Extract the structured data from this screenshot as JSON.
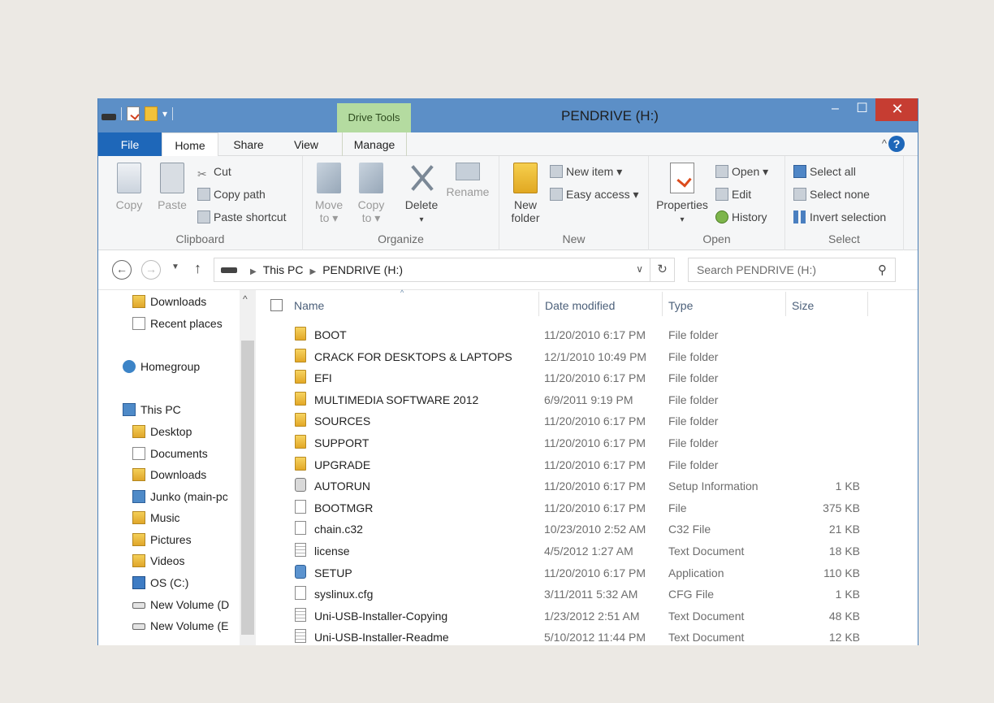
{
  "window": {
    "title": "PENDRIVE (H:)",
    "contextual_tab": "Drive Tools",
    "controls": {
      "minimize": "–",
      "maximize": "☐",
      "close": "✕"
    },
    "qat_dropdown": "▾"
  },
  "tabs": [
    {
      "label": "File"
    },
    {
      "label": "Home"
    },
    {
      "label": "Share"
    },
    {
      "label": "View"
    },
    {
      "label": "Manage"
    }
  ],
  "ribbon_misc": {
    "collapse": "^",
    "help": "?"
  },
  "ribbon": {
    "clipboard": {
      "label": "Clipboard",
      "copy": "Copy",
      "paste": "Paste",
      "cut": "Cut",
      "copy_path": "Copy path",
      "paste_shortcut": "Paste shortcut"
    },
    "organize": {
      "label": "Organize",
      "move_to_1": "Move",
      "move_to_2": "to ▾",
      "copy_to_1": "Copy",
      "copy_to_2": "to ▾",
      "delete": "Delete",
      "delete_dd": "▾",
      "rename": "Rename"
    },
    "new": {
      "label": "New",
      "new_folder_1": "New",
      "new_folder_2": "folder",
      "new_item": "New item ▾",
      "easy_access": "Easy access ▾"
    },
    "open": {
      "label": "Open",
      "properties": "Properties",
      "properties_dd": "▾",
      "open": "Open ▾",
      "edit": "Edit",
      "history": "History"
    },
    "select": {
      "label": "Select",
      "select_all": "Select all",
      "select_none": "Select none",
      "invert_selection": "Invert selection"
    }
  },
  "address": {
    "back": "←",
    "forward": "→",
    "recent": "▼",
    "up": "↑",
    "crumbs": [
      "This PC",
      "PENDRIVE (H:)"
    ],
    "crumb_sep": "▶",
    "dropdown": "∨",
    "refresh": "↻",
    "search_placeholder": "Search PENDRIVE (H:)",
    "search_glyph": "⚲"
  },
  "navpane": {
    "scroll_up": "^",
    "items": [
      {
        "label": "Downloads"
      },
      {
        "label": "Recent places"
      },
      {
        "label": "Homegroup"
      },
      {
        "label": "This PC"
      },
      {
        "label": "Desktop"
      },
      {
        "label": "Documents"
      },
      {
        "label": "Downloads"
      },
      {
        "label": "Junko (main-pc"
      },
      {
        "label": "Music"
      },
      {
        "label": "Pictures"
      },
      {
        "label": "Videos"
      },
      {
        "label": "OS (C:)"
      },
      {
        "label": "New Volume (D"
      },
      {
        "label": "New Volume (E"
      }
    ]
  },
  "columns": {
    "name": "Name",
    "date": "Date modified",
    "type": "Type",
    "size": "Size",
    "sort_arrow": "^"
  },
  "files": [
    {
      "name": "BOOT",
      "date": "11/20/2010 6:17 PM",
      "type": "File folder",
      "size": "",
      "icon": "folder-icon"
    },
    {
      "name": "CRACK FOR DESKTOPS & LAPTOPS",
      "date": "12/1/2010 10:49 PM",
      "type": "File folder",
      "size": "",
      "icon": "folder-icon"
    },
    {
      "name": "EFI",
      "date": "11/20/2010 6:17 PM",
      "type": "File folder",
      "size": "",
      "icon": "folder-icon"
    },
    {
      "name": "MULTIMEDIA SOFTWARE 2012",
      "date": "6/9/2011 9:19 PM",
      "type": "File folder",
      "size": "",
      "icon": "folder-icon"
    },
    {
      "name": "SOURCES",
      "date": "11/20/2010 6:17 PM",
      "type": "File folder",
      "size": "",
      "icon": "folder-icon"
    },
    {
      "name": "SUPPORT",
      "date": "11/20/2010 6:17 PM",
      "type": "File folder",
      "size": "",
      "icon": "folder-icon"
    },
    {
      "name": "UPGRADE",
      "date": "11/20/2010 6:17 PM",
      "type": "File folder",
      "size": "",
      "icon": "folder-icon"
    },
    {
      "name": "AUTORUN",
      "date": "11/20/2010 6:17 PM",
      "type": "Setup Information",
      "size": "1 KB",
      "icon": "setup-info-icon"
    },
    {
      "name": "BOOTMGR",
      "date": "11/20/2010 6:17 PM",
      "type": "File",
      "size": "375 KB",
      "icon": "file-icon"
    },
    {
      "name": "chain.c32",
      "date": "10/23/2010 2:52 AM",
      "type": "C32 File",
      "size": "21 KB",
      "icon": "file-icon"
    },
    {
      "name": "license",
      "date": "4/5/2012 1:27 AM",
      "type": "Text Document",
      "size": "18 KB",
      "icon": "text-document-icon"
    },
    {
      "name": "SETUP",
      "date": "11/20/2010 6:17 PM",
      "type": "Application",
      "size": "110 KB",
      "icon": "application-icon"
    },
    {
      "name": "syslinux.cfg",
      "date": "3/11/2011 5:32 AM",
      "type": "CFG File",
      "size": "1 KB",
      "icon": "file-icon"
    },
    {
      "name": "Uni-USB-Installer-Copying",
      "date": "1/23/2012 2:51 AM",
      "type": "Text Document",
      "size": "48 KB",
      "icon": "text-document-icon"
    },
    {
      "name": "Uni-USB-Installer-Readme",
      "date": "5/10/2012 11:44 PM",
      "type": "Text Document",
      "size": "12 KB",
      "icon": "text-document-icon"
    }
  ]
}
